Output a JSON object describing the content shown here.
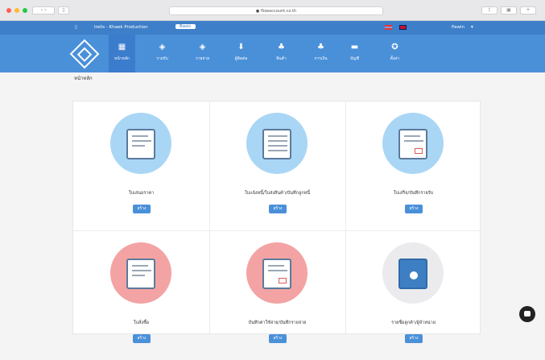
{
  "browser": {
    "url": "● flowaccount.co.th",
    "tab_btn": "»|",
    "colors": {
      "close": "#ff5f57",
      "min": "#febc2e",
      "max": "#28c840"
    }
  },
  "topbar": {
    "brand": "Irelis - Khaek Production",
    "badge": "Basic",
    "user": "Pawin"
  },
  "nav": {
    "items": [
      {
        "label": "หน้าหลัก",
        "icon": "▦"
      },
      {
        "label": "รายรับ",
        "icon": "◈"
      },
      {
        "label": "รายจ่าย",
        "icon": "◈"
      },
      {
        "label": "ผู้ติดต่อ",
        "icon": "⬇"
      },
      {
        "label": "สินค้า",
        "icon": "♣"
      },
      {
        "label": "การเงิน",
        "icon": "♣"
      },
      {
        "label": "บัญชี",
        "icon": "▬"
      },
      {
        "label": "ตั้งค่า",
        "icon": "✪"
      }
    ]
  },
  "breadcrumb": "หน้าหลัก",
  "tiles": [
    {
      "label": "ใบเสนอราคา",
      "button": "สร้าง",
      "color": "#a9d6f5"
    },
    {
      "label": "ใบแจ้งหนี้/ใบส่งสินค้า/บันทึกลูกหนี้",
      "button": "สร้าง",
      "color": "#a9d6f5"
    },
    {
      "label": "ใบเสร็จ/บันทึกรายรับ",
      "button": "สร้าง",
      "color": "#a9d6f5"
    },
    {
      "label": "ใบสั่งซื้อ",
      "button": "สร้าง",
      "color": "#f3a3a3"
    },
    {
      "label": "บันทึกค่าใช้จ่าย/บันทึกรายจ่าย",
      "button": "สร้าง",
      "color": "#f3a3a3"
    },
    {
      "label": "รายชื่อลูกค้า/ผู้จำหน่าย",
      "button": "สร้าง",
      "color": "#ebebed"
    }
  ]
}
